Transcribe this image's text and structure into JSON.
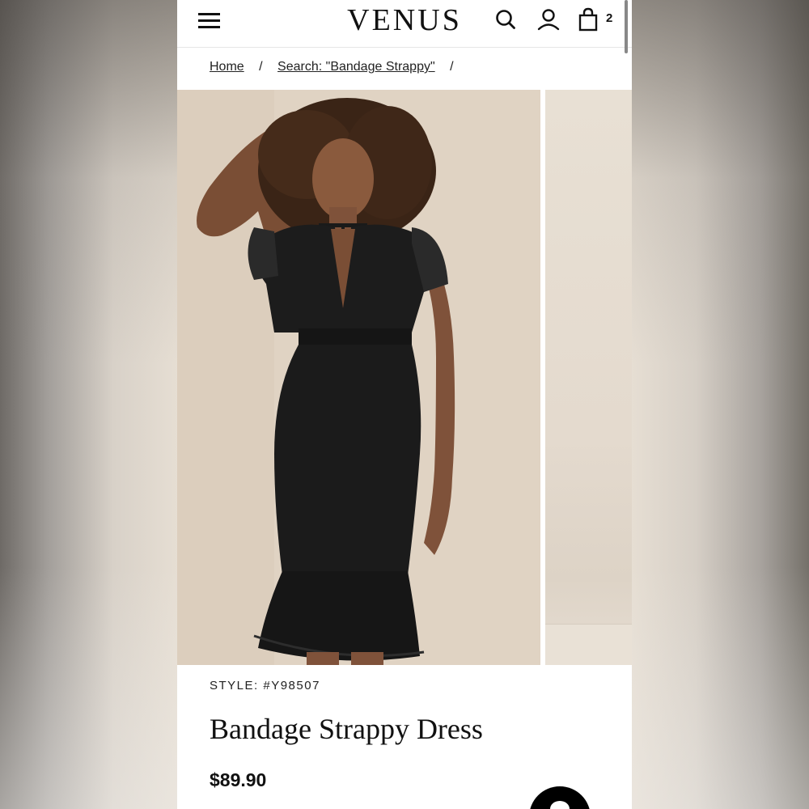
{
  "header": {
    "brand": "VENUS",
    "menu_icon": "hamburger-menu-icon",
    "search_icon": "search-icon",
    "account_icon": "account-icon",
    "bag_icon": "shopping-bag-icon",
    "bag_count": "2"
  },
  "breadcrumb": {
    "items": [
      {
        "label": "Home"
      },
      {
        "label": "Search: \"Bandage Strappy\""
      }
    ],
    "separator": "/"
  },
  "product": {
    "style": "STYLE: #Y98507",
    "title": "Bandage Strappy Dress",
    "price": "$89.90"
  },
  "chat": {
    "icon": "chat-icon"
  }
}
